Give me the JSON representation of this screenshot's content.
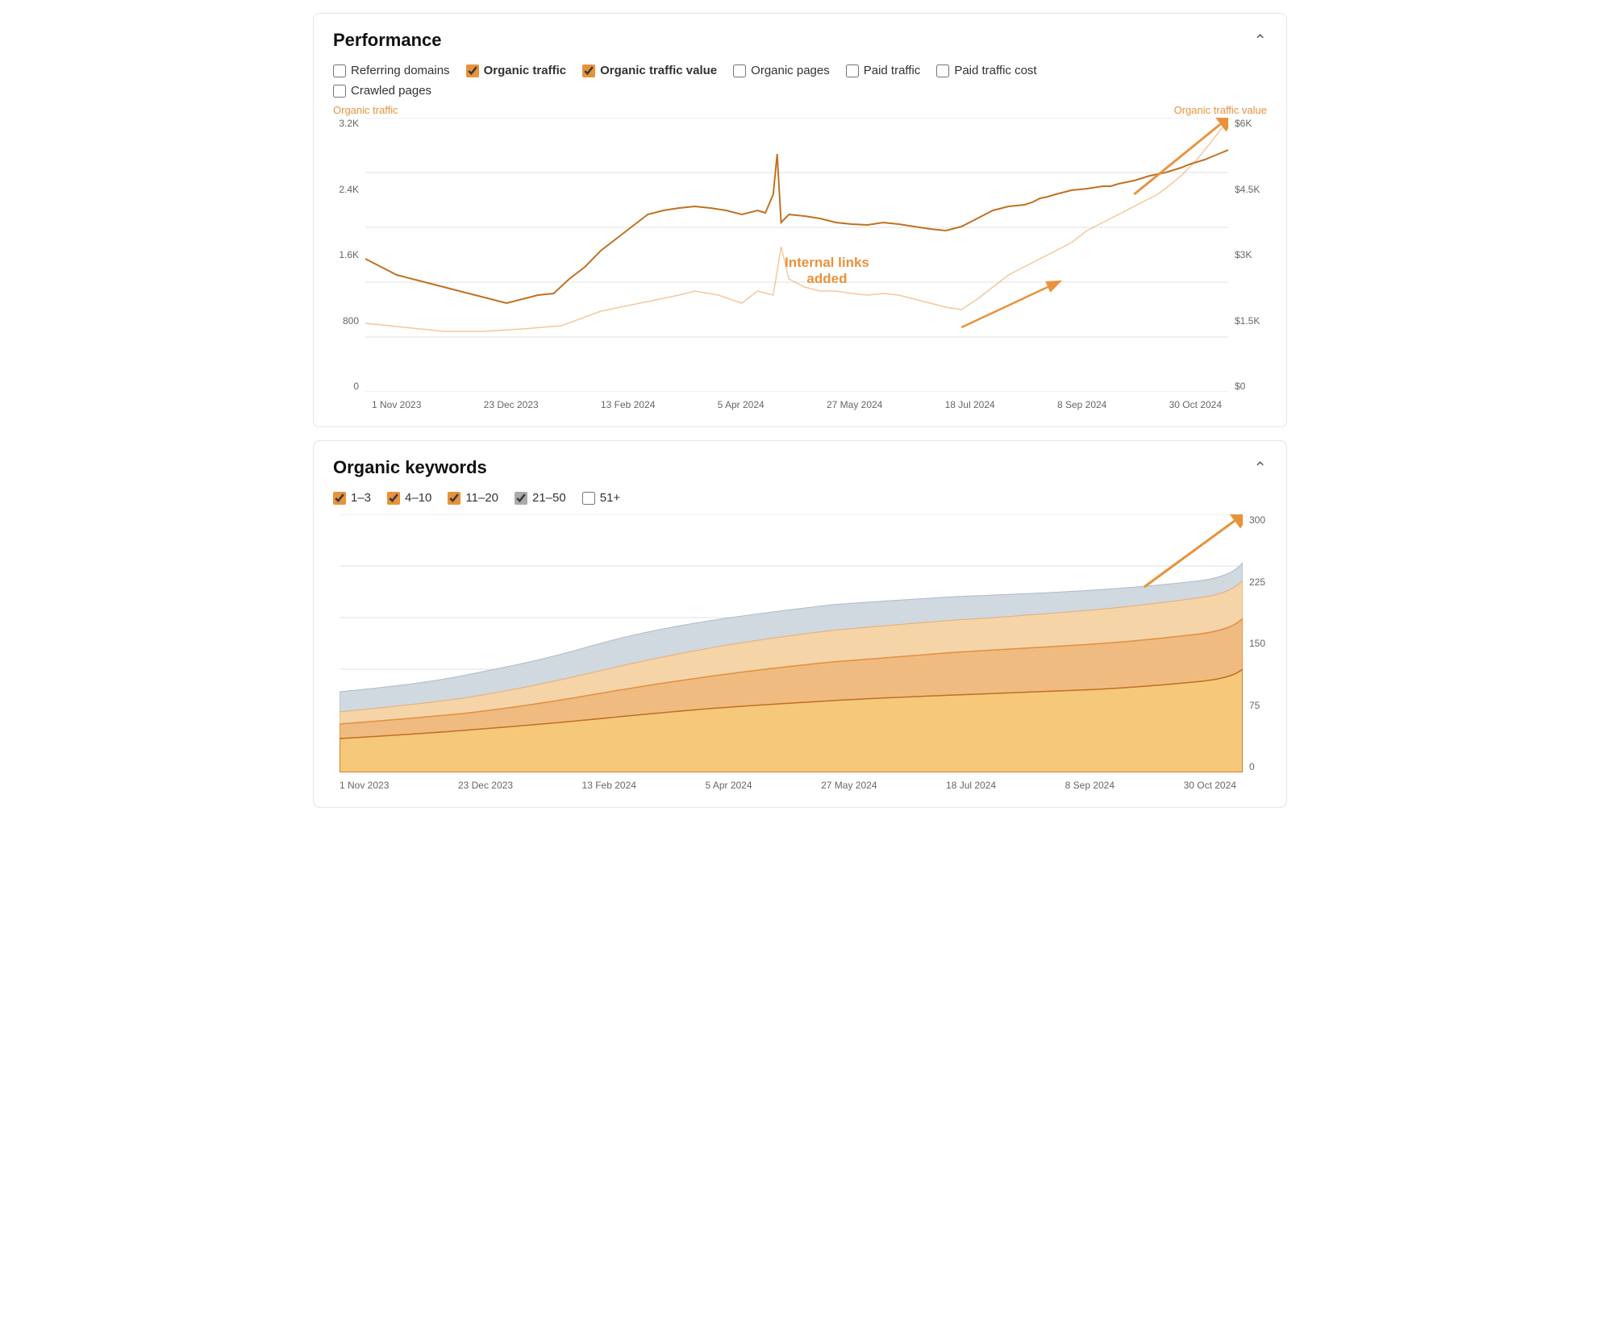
{
  "performance": {
    "title": "Performance",
    "checkboxes": [
      {
        "id": "referring_domains",
        "label": "Referring domains",
        "checked": false,
        "bold": false
      },
      {
        "id": "organic_traffic",
        "label": "Organic traffic",
        "checked": true,
        "bold": true
      },
      {
        "id": "organic_traffic_value",
        "label": "Organic traffic value",
        "checked": true,
        "bold": true
      },
      {
        "id": "organic_pages",
        "label": "Organic pages",
        "checked": false,
        "bold": false
      },
      {
        "id": "paid_traffic",
        "label": "Paid traffic",
        "checked": false,
        "bold": false
      },
      {
        "id": "paid_traffic_cost",
        "label": "Paid traffic cost",
        "checked": false,
        "bold": false
      },
      {
        "id": "crawled_pages",
        "label": "Crawled pages",
        "checked": false,
        "bold": false
      }
    ],
    "chart": {
      "left_label": "Organic traffic",
      "right_label": "Organic traffic value",
      "y_left": [
        "3.2K",
        "2.4K",
        "1.6K",
        "800",
        "0"
      ],
      "y_right": [
        "$6K",
        "$4.5K",
        "$3K",
        "$1.5K",
        "$0"
      ],
      "x_labels": [
        "1 Nov 2023",
        "23 Dec 2023",
        "13 Feb 2024",
        "5 Apr 2024",
        "27 May 2024",
        "18 Jul 2024",
        "8 Sep 2024",
        "30 Oct 2024"
      ],
      "annotation_text": "Internal links\nadded"
    }
  },
  "organic_keywords": {
    "title": "Organic keywords",
    "checkboxes": [
      {
        "id": "kw_1_3",
        "label": "1–3",
        "checked": true
      },
      {
        "id": "kw_4_10",
        "label": "4–10",
        "checked": true
      },
      {
        "id": "kw_11_20",
        "label": "11–20",
        "checked": true
      },
      {
        "id": "kw_21_50",
        "label": "21–50",
        "checked": true,
        "light": true
      },
      {
        "id": "kw_51plus",
        "label": "51+",
        "checked": false
      }
    ],
    "chart": {
      "y_right": [
        "300",
        "225",
        "150",
        "75",
        "0"
      ],
      "x_labels": [
        "1 Nov 2023",
        "23 Dec 2023",
        "13 Feb 2024",
        "5 Apr 2024",
        "27 May 2024",
        "18 Jul 2024",
        "8 Sep 2024",
        "30 Oct 2024"
      ]
    }
  }
}
